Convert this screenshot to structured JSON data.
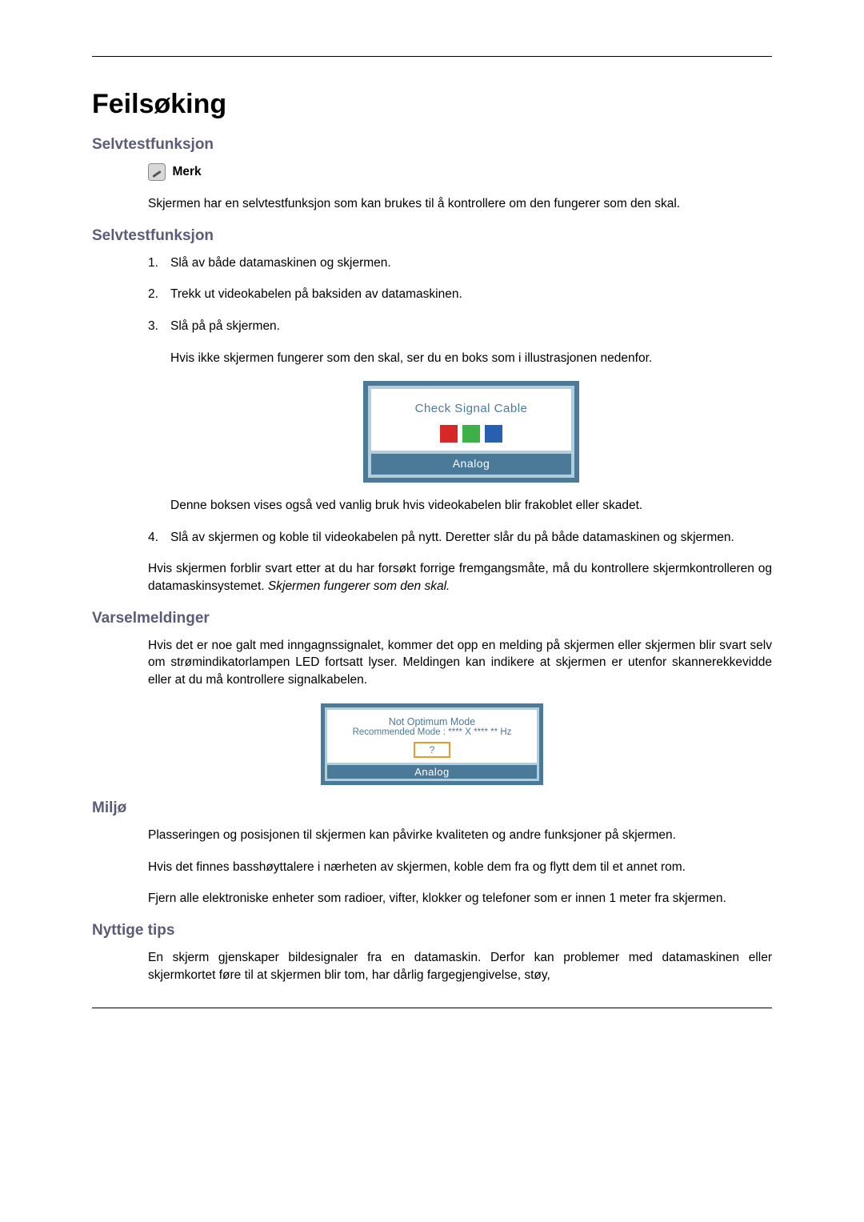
{
  "title": "Feilsøking",
  "section1": {
    "heading": "Selvtestfunksjon",
    "noteLabel": "Merk",
    "noteText": "Skjermen har en selvtestfunksjon som kan brukes til å kontrollere om den fungerer som den skal."
  },
  "section2": {
    "heading": "Selvtestfunksjon",
    "steps": {
      "s1": "Slå av både datamaskinen og skjermen.",
      "s2": "Trekk ut videokabelen på baksiden av datamaskinen.",
      "s3": "Slå på på skjermen.",
      "s3sub": "Hvis ikke skjermen fungerer som den skal, ser du en boks som i illustrasjonen nedenfor.",
      "s3after": "Denne boksen vises også ved vanlig bruk hvis videokabelen blir frakoblet eller skadet.",
      "s4": "Slå av skjermen og koble til videokabelen på nytt. Deretter slår du på både datamaskinen og skjermen."
    },
    "afterSteps": "Hvis skjermen forblir svart etter at du har forsøkt forrige fremgangsmåte, må du kontrollere skjermkontrolleren og datamaskinsystemet. ",
    "afterStepsItalic": "Skjermen fungerer som den skal."
  },
  "illus1": {
    "title": "Check Signal Cable",
    "footer": "Analog"
  },
  "section3": {
    "heading": "Varselmeldinger",
    "text": "Hvis det er noe galt med inngagnssignalet, kommer det opp en melding på skjermen eller skjermen blir svart selv om strømindikatorlampen LED fortsatt lyser. Meldingen kan indikere at skjermen er utenfor skannerekkevidde eller at du må kontrollere signalkabelen."
  },
  "illus2": {
    "line1": "Not Optimum Mode",
    "line2": "Recommended Mode : **** X **** ** Hz",
    "btn": "?",
    "footer": "Analog"
  },
  "section4": {
    "heading": "Miljø",
    "p1": "Plasseringen og posisjonen til skjermen kan påvirke kvaliteten og andre funksjoner på skjermen.",
    "p2": "Hvis det finnes basshøyttalere i nærheten av skjermen, koble dem fra og flytt dem til et annet rom.",
    "p3": "Fjern alle elektroniske enheter som radioer, vifter, klokker og telefoner som er innen 1 meter fra skjermen."
  },
  "section5": {
    "heading": "Nyttige tips",
    "p1": "En skjerm gjenskaper bildesignaler fra en datamaskin. Derfor kan problemer med datamaskinen eller skjermkortet føre til at skjermen blir tom, har dårlig fargegjengivelse, støy,"
  }
}
